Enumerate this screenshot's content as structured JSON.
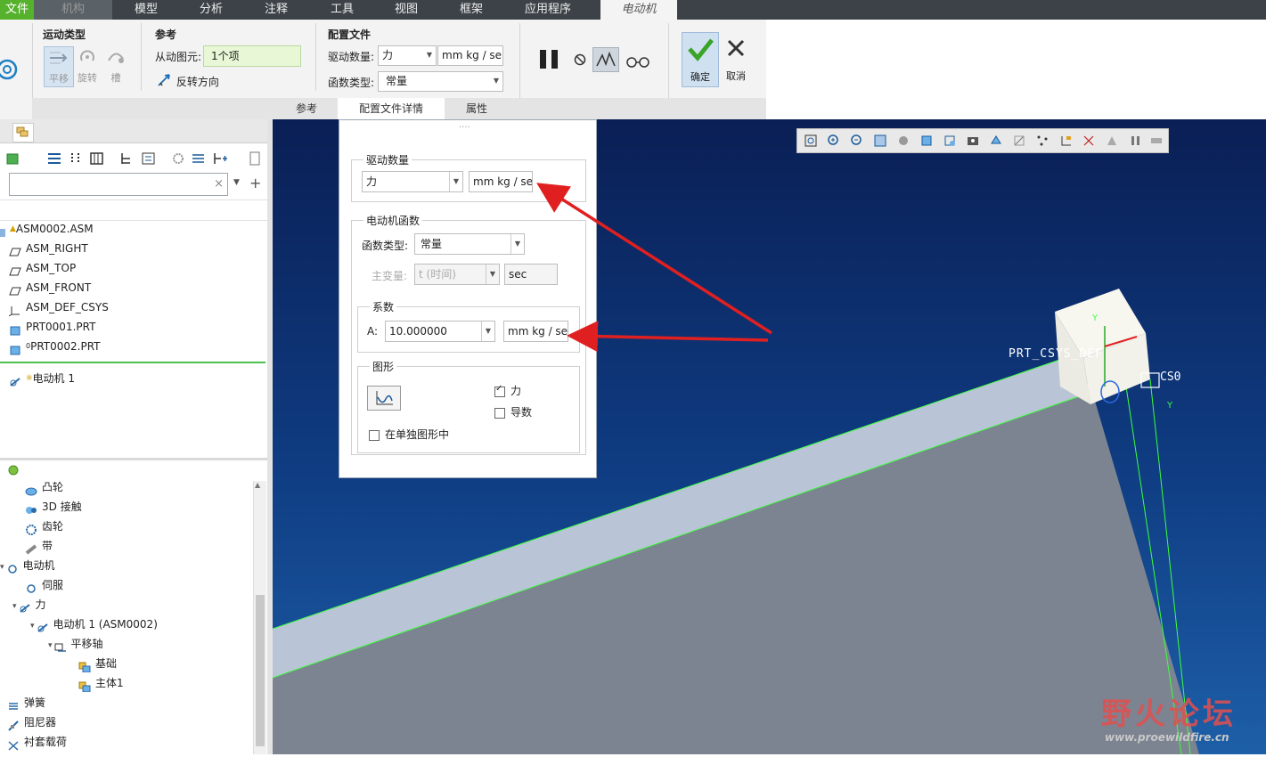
{
  "menu": {
    "items": [
      "文件",
      "机构",
      "模型",
      "分析",
      "注释",
      "工具",
      "视图",
      "框架",
      "应用程序",
      "电动机"
    ]
  },
  "ribbon": {
    "motion_type": {
      "title": "运动类型",
      "translate": "平移",
      "rotate": "旋转",
      "slot": "槽"
    },
    "reference": {
      "title": "参考",
      "from_label": "从动图元:",
      "from_value": "1个项",
      "reverse": "反转方向"
    },
    "profile": {
      "title": "配置文件",
      "drive_qty_label": "驱动数量:",
      "drive_qty_value": "力",
      "drive_unit": "mm kg / se",
      "func_type_label": "函数类型:",
      "func_type_value": "常量"
    },
    "confirm": "确定",
    "cancel": "取消",
    "tabs": [
      "参考",
      "配置文件详情",
      "属性"
    ]
  },
  "dialog": {
    "grip": "....",
    "drive_group": {
      "title": "驱动数量",
      "qty": "力",
      "unit": "mm kg / se"
    },
    "func_group": {
      "title": "电动机函数",
      "type_label": "函数类型:",
      "type_value": "常量",
      "var_label": "主变量:",
      "var_value": "t (时间)",
      "var_unit": "sec"
    },
    "coef_group": {
      "title": "系数",
      "a_label": "A:",
      "a_value": "10.000000",
      "a_unit": "mm kg / se"
    },
    "graph_group": {
      "title": "图形",
      "force": "力",
      "derivative": "导数",
      "single_graph": "在单独图形中"
    },
    "checks": {
      "force": true,
      "derivative": false,
      "single_graph": false
    }
  },
  "model_tree": [
    {
      "label": "ASM0002.ASM"
    },
    {
      "label": "ASM_RIGHT"
    },
    {
      "label": "ASM_TOP"
    },
    {
      "label": "ASM_FRONT"
    },
    {
      "label": "ASM_DEF_CSYS"
    },
    {
      "label": "PRT0001.PRT"
    },
    {
      "label": "PRT0002.PRT"
    },
    {
      "label": "电动机 1"
    }
  ],
  "mech_tree": [
    {
      "label": "凸轮"
    },
    {
      "label": "3D 接触"
    },
    {
      "label": "齿轮"
    },
    {
      "label": "带"
    },
    {
      "label": "电动机"
    },
    {
      "label": "伺服"
    },
    {
      "label": "力"
    },
    {
      "label": "电动机 1 (ASM0002)"
    },
    {
      "label": "平移轴"
    },
    {
      "label": "基础"
    },
    {
      "label": "主体1"
    },
    {
      "label": "弹簧"
    },
    {
      "label": "阻尼器"
    },
    {
      "label": "衬套载荷"
    }
  ],
  "viewport": {
    "csys_label": "PRT_CSYS_DEF",
    "csys2_label": "CS0",
    "axis_y": "Y",
    "watermark_cn": "野火论坛",
    "watermark_url": "www.proewildfire.cn"
  },
  "colors": {
    "accent_green": "#56b12d",
    "arrow_red": "#e02020",
    "viewport_blue": "#0f3c82"
  }
}
